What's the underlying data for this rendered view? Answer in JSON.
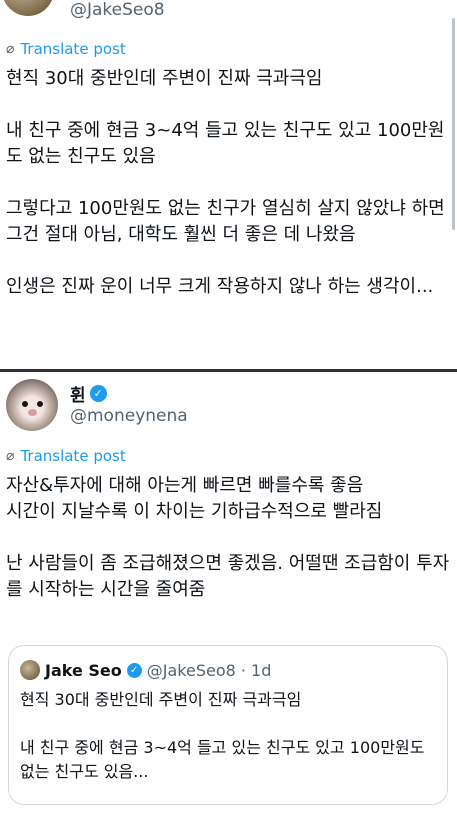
{
  "post1": {
    "handle": "@JakeSeo8",
    "translate_label": "Translate post",
    "body": "현직 30대 중반인데 주변이 진짜 극과극임\n\n내 친구 중에 현금 3~4억 들고 있는 친구도 있고 100만원도 없는 친구도 있음\n\n그렇다고 100만원도 없는 친구가 열심히 살지 않았냐 하면 그건 절대 아님, 대학도 훨씬 더 좋은 데 나왔음\n\n인생은 진짜 운이 너무 크게 작용하지 않나 하는 생각이..."
  },
  "post2": {
    "name": "휜",
    "handle": "@moneynena",
    "translate_label": "Translate post",
    "body": "자산&투자에 대해 아는게 빠르면 빠를수록 좋음\n시간이 지날수록 이 차이는 기하급수적으로 빨라짐\n\n난 사람들이 좀 조급해졌으면 좋겠음. 어떨땐 조급함이 투자를 시작하는 시간을 줄여줌"
  },
  "quote": {
    "name": "Jake Seo",
    "handle_time": "@JakeSeo8 · 1d",
    "body": "현직 30대 중반인데 주변이 진짜 극과극임\n\n내 친구 중에 현금 3~4억 들고 있는 친구도 있고 100만원도 없는 친구도 있음..."
  },
  "icons": {
    "translate": "globe-icon",
    "verified": "verified-badge-icon"
  },
  "colors": {
    "link": "#1d9bf0",
    "secondary_text": "#536471",
    "verified": "#1d9bf0"
  }
}
